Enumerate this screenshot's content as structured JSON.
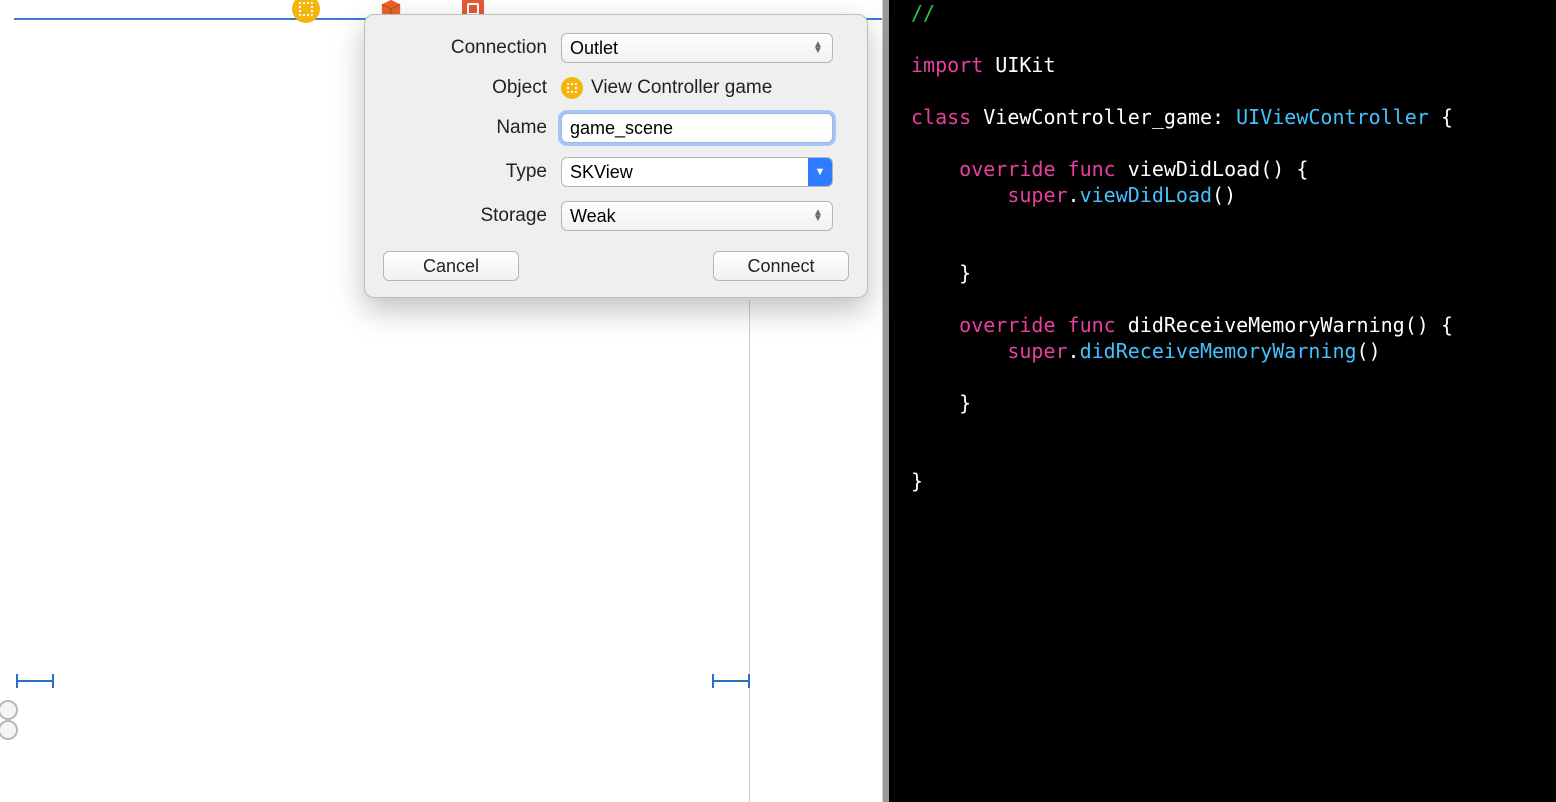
{
  "popover": {
    "labels": {
      "connection": "Connection",
      "object": "Object",
      "name": "Name",
      "type": "Type",
      "storage": "Storage"
    },
    "connection_value": "Outlet",
    "object_value": "View Controller game",
    "name_value": "game_scene",
    "type_value": "SKView",
    "storage_value": "Weak",
    "cancel_label": "Cancel",
    "connect_label": "Connect"
  },
  "code": {
    "lines": [
      {
        "segments": [
          {
            "t": "//",
            "c": "comment"
          }
        ]
      },
      {
        "segments": []
      },
      {
        "segments": [
          {
            "t": "import",
            "c": "keyword"
          },
          {
            "t": " UIKit",
            "c": "user"
          }
        ]
      },
      {
        "segments": []
      },
      {
        "segments": [
          {
            "t": "class",
            "c": "keyword"
          },
          {
            "t": " ViewController_game: ",
            "c": "user"
          },
          {
            "t": "UIViewController",
            "c": "type"
          },
          {
            "t": " {",
            "c": "user"
          }
        ]
      },
      {
        "segments": []
      },
      {
        "segments": [
          {
            "t": "    ",
            "c": "user"
          },
          {
            "t": "override",
            "c": "keyword"
          },
          {
            "t": " ",
            "c": "user"
          },
          {
            "t": "func",
            "c": "keyword"
          },
          {
            "t": " viewDidLoad() {",
            "c": "user"
          }
        ]
      },
      {
        "segments": [
          {
            "t": "        ",
            "c": "user"
          },
          {
            "t": "super",
            "c": "keyword"
          },
          {
            "t": ".",
            "c": "user"
          },
          {
            "t": "viewDidLoad",
            "c": "type"
          },
          {
            "t": "()",
            "c": "user"
          }
        ]
      },
      {
        "segments": []
      },
      {
        "segments": []
      },
      {
        "segments": [
          {
            "t": "    }",
            "c": "user"
          }
        ]
      },
      {
        "segments": []
      },
      {
        "segments": [
          {
            "t": "    ",
            "c": "user"
          },
          {
            "t": "override",
            "c": "keyword"
          },
          {
            "t": " ",
            "c": "user"
          },
          {
            "t": "func",
            "c": "keyword"
          },
          {
            "t": " didReceiveMemoryWarning() {",
            "c": "user"
          }
        ]
      },
      {
        "segments": [
          {
            "t": "        ",
            "c": "user"
          },
          {
            "t": "super",
            "c": "keyword"
          },
          {
            "t": ".",
            "c": "user"
          },
          {
            "t": "didReceiveMemoryWarning",
            "c": "type"
          },
          {
            "t": "()",
            "c": "user"
          }
        ]
      },
      {
        "segments": []
      },
      {
        "segments": [
          {
            "t": "    }",
            "c": "user"
          }
        ]
      },
      {
        "segments": []
      },
      {
        "segments": []
      },
      {
        "segments": [
          {
            "t": "}",
            "c": "user"
          }
        ]
      }
    ]
  }
}
